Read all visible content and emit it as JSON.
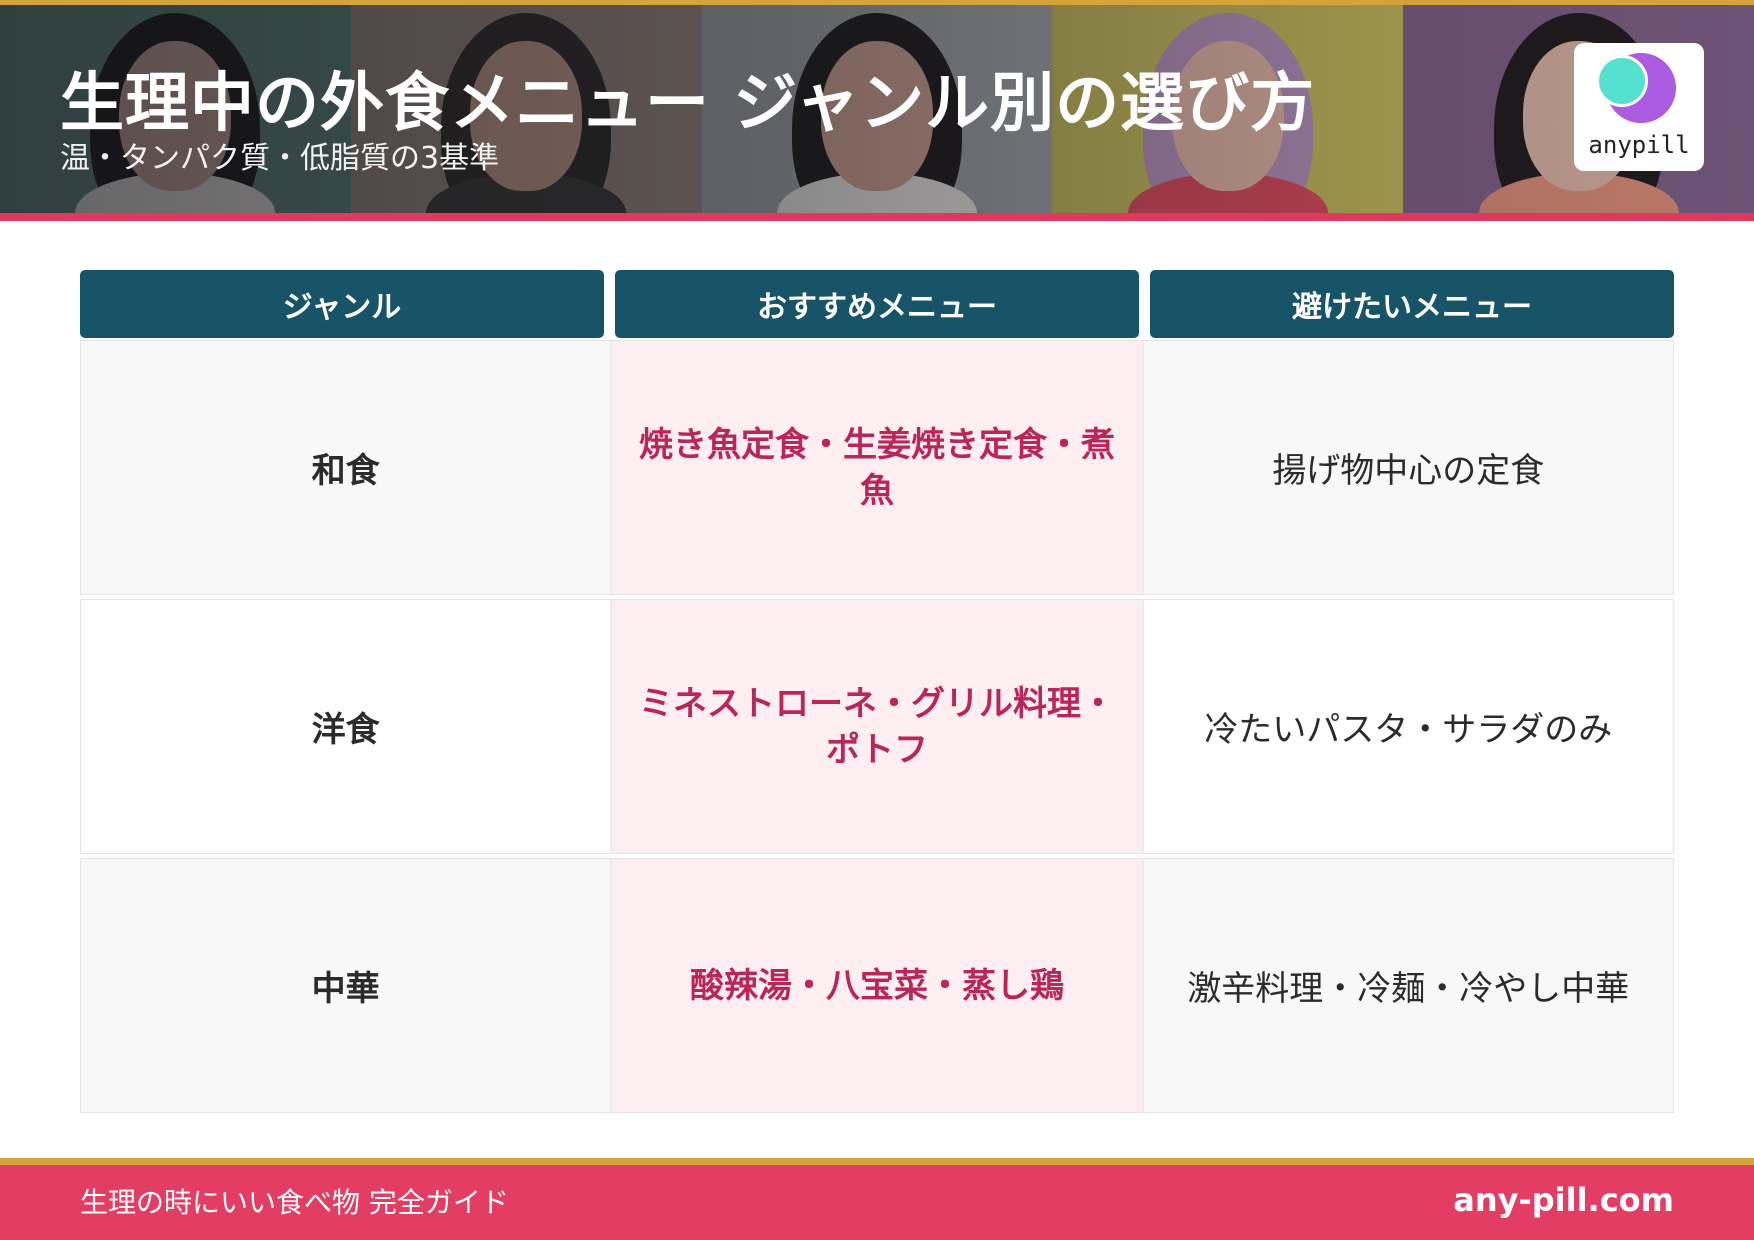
{
  "header": {
    "title": "生理中の外食メニュー ジャンル別の選び方",
    "subtitle": "温・タンパク質・低脂質の3基準",
    "logo_text": "anypill"
  },
  "table": {
    "headers": [
      "ジャンル",
      "おすすめメニュー",
      "避けたいメニュー"
    ],
    "rows": [
      {
        "genre": "和食",
        "recommended": "焼き魚定食・生姜焼き定食・煮魚",
        "avoid": "揚げ物中心の定食"
      },
      {
        "genre": "洋食",
        "recommended": "ミネストローネ・グリル料理・ポトフ",
        "avoid": "冷たいパスタ・サラダのみ"
      },
      {
        "genre": "中華",
        "recommended": "酸辣湯・八宝菜・蒸し鶏",
        "avoid": "激辛料理・冷麺・冷やし中華"
      }
    ]
  },
  "footer": {
    "guide_title": "生理の時にいい食べ物 完全ガイド",
    "site": "any-pill.com"
  },
  "colors": {
    "header_accent_gold": "#d4a43a",
    "brand_pink": "#e33d63",
    "table_header": "#185468",
    "recommended_text": "#b8265a",
    "recommended_bg": "#fdeef1"
  }
}
